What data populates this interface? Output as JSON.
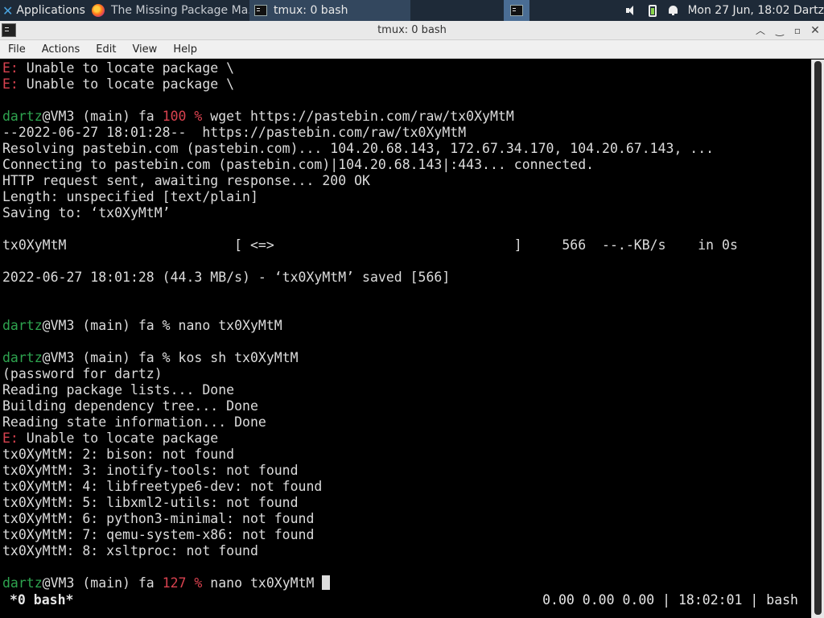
{
  "panel": {
    "applications": "Applications",
    "task_browser": "The Missing Package Ma...",
    "task_terminal": "tmux: 0 bash",
    "clock": "Mon 27 Jun, 18:02",
    "user": "Dartz"
  },
  "window": {
    "title": "tmux: 0 bash"
  },
  "menu": {
    "file": "File",
    "actions": "Actions",
    "edit": "Edit",
    "view": "View",
    "help": "Help"
  },
  "terminal": {
    "l0_e": "E:",
    "l0": " Unable to locate package \\",
    "l1_e": "E:",
    "l1": " Unable to locate package \\",
    "p2_user": "dartz",
    "p2_mid": "@VM3 (main) fa ",
    "p2_code": "100 %",
    "p2_cmd": " wget https://pastebin.com/raw/tx0XyMtM",
    "l4": "--2022-06-27 18:01:28--  https://pastebin.com/raw/tx0XyMtM",
    "l5": "Resolving pastebin.com (pastebin.com)... 104.20.68.143, 172.67.34.170, 104.20.67.143, ...",
    "l6": "Connecting to pastebin.com (pastebin.com)|104.20.68.143|:443... connected.",
    "l7": "HTTP request sent, awaiting response... 200 OK",
    "l8": "Length: unspecified [text/plain]",
    "l9": "Saving to: ‘tx0XyMtM’",
    "l11": "tx0XyMtM                     [ <=>                              ]     566  --.-KB/s    in 0s",
    "l13": "2022-06-27 18:01:28 (44.3 MB/s) - ‘tx0XyMtM’ saved [566]",
    "p16_user": "dartz",
    "p16_rest": "@VM3 (main) fa % nano tx0XyMtM",
    "p18_user": "dartz",
    "p18_rest": "@VM3 (main) fa % kos sh tx0XyMtM",
    "l19": "(password for dartz)",
    "l20": "Reading package lists... Done",
    "l21": "Building dependency tree... Done",
    "l22": "Reading state information... Done",
    "l23_e": "E:",
    "l23": " Unable to locate package",
    "l24": "tx0XyMtM: 2: bison: not found",
    "l25": "tx0XyMtM: 3: inotify-tools: not found",
    "l26": "tx0XyMtM: 4: libfreetype6-dev: not found",
    "l27": "tx0XyMtM: 5: libxml2-utils: not found",
    "l28": "tx0XyMtM: 6: python3-minimal: not found",
    "l29": "tx0XyMtM: 7: qemu-system-x86: not found",
    "l30": "tx0XyMtM: 8: xsltproc: not found",
    "p32_user": "dartz",
    "p32_mid": "@VM3 (main) fa ",
    "p32_code": "127 %",
    "p32_cmd": " nano tx0XyMtM "
  },
  "status": {
    "left": "*0 bash*",
    "right": "0.00 0.00 0.00 | 18:02:01 | bash"
  },
  "colors": {
    "user_prompt": "#2ea44f",
    "error": "#d9424f",
    "panel_bg": "#1e2a38"
  }
}
